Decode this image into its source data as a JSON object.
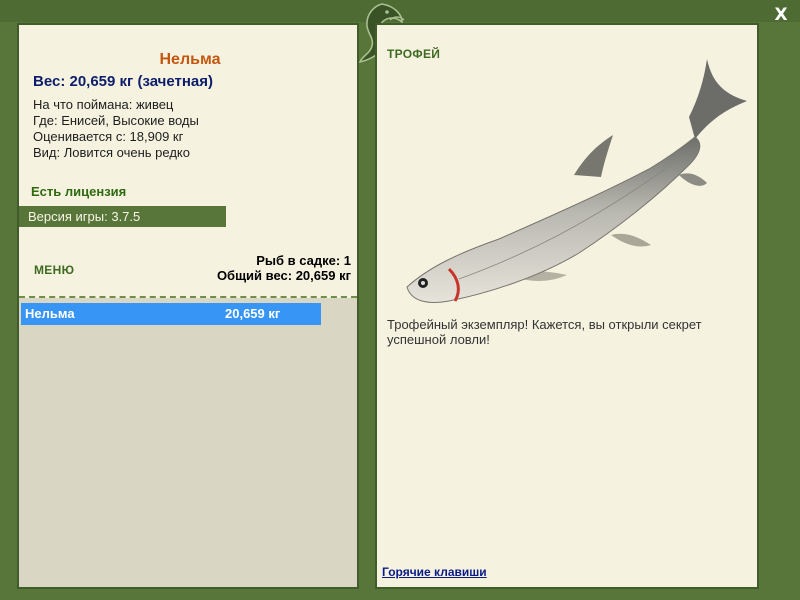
{
  "window": {
    "close_label": "X"
  },
  "fish": {
    "name": "Нельма",
    "weight_line": "Вес: 20,659 кг (зачетная)",
    "caught_on": "На что поймана: живец",
    "location": "Где: Енисей, Высокие воды",
    "valued_from": "Оценивается с: 18,909 кг",
    "rarity": "Вид: Ловится очень редко"
  },
  "license_text": "Есть лицензия",
  "version_text": "Версия игры: 3.7.5",
  "menu_label": "МЕНЮ",
  "keepnet": {
    "count_line": "Рыб в садке: 1",
    "total_line": "Общий вес: 20,659 кг"
  },
  "catch_list": [
    {
      "name": "Нельма",
      "weight": "20,659 кг",
      "selected": true
    }
  ],
  "trophy": {
    "title": "ТРОФЕЙ",
    "message": "Трофейный экземпляр! Кажется, вы открыли секрет успешной ловли!"
  },
  "hotkeys_link": "Горячие клавиши",
  "colors": {
    "frame_green": "#58763a",
    "panel_bg": "#f5f3e0",
    "fish_name": "#c4560f",
    "weight_text": "#0d1d6b",
    "license_text": "#2f6a10",
    "selection": "#3795f5",
    "link": "#0a1a8a"
  }
}
